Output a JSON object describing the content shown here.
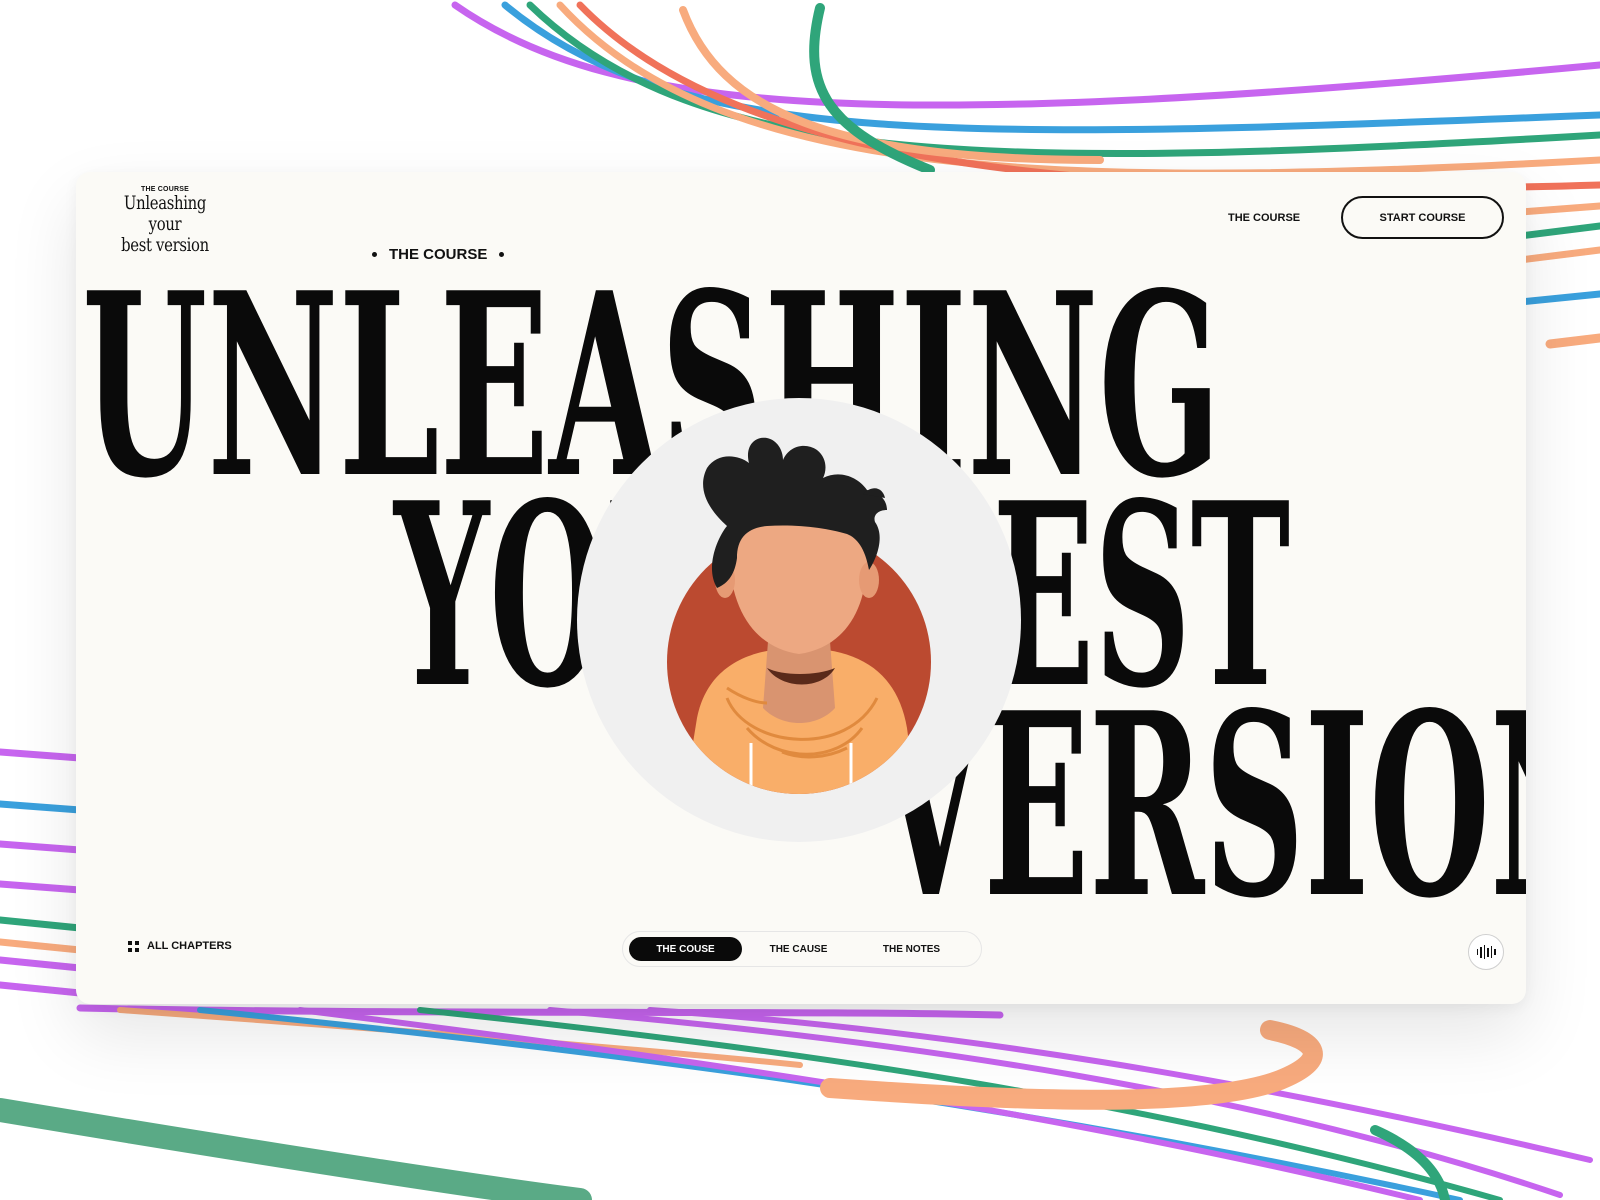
{
  "brand": {
    "kicker": "THE COURSE",
    "title_line1": "Unleashing your",
    "title_line2": "best version"
  },
  "header": {
    "nav_link": "THE COURSE",
    "cta_label": "START COURSE"
  },
  "hero": {
    "kicker": "THE COURSE",
    "line1": "UNLEASHING",
    "line2": "YOUR BEST",
    "line3": "VERSION"
  },
  "footer": {
    "chapters_label": "ALL CHAPTERS",
    "tabs": [
      {
        "label": "THE COUSE",
        "active": true
      },
      {
        "label": "THE CAUSE",
        "active": false
      },
      {
        "label": "THE NOTES",
        "active": false
      }
    ]
  },
  "colors": {
    "purple": "#c765ef",
    "blue": "#3aa0dd",
    "green": "#2fa57a",
    "peach": "#f8ab7e",
    "coral": "#f0725a",
    "card_bg": "#fbfaf6",
    "avatar_backdrop": "#bb4a30",
    "hoodie": "#f9ae69",
    "skin": "#eda882",
    "hair": "#1f1f1f"
  },
  "icons": {
    "chapters": "grid-icon",
    "sound": "audio-wave-icon"
  }
}
